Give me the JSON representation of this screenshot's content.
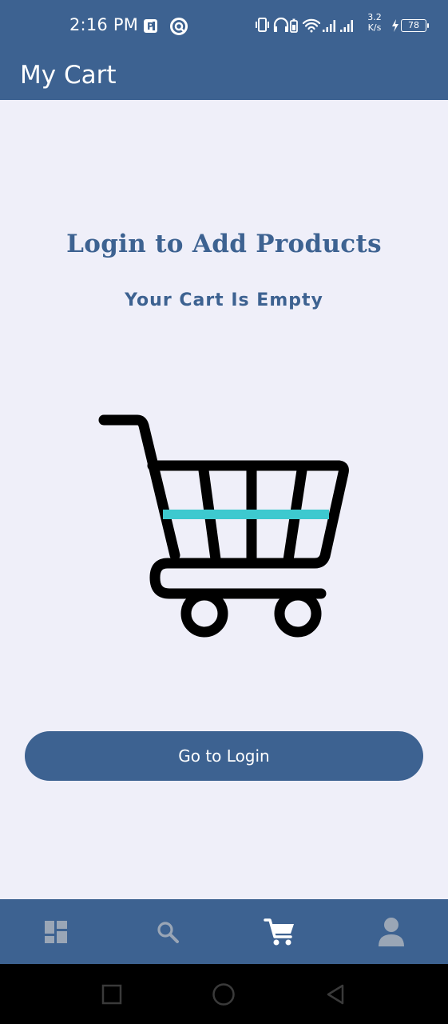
{
  "status_bar": {
    "time": "2:16 PM",
    "network_speed_value": "3.2",
    "network_speed_unit": "K/s",
    "battery_level": "78",
    "icons": [
      "parking-notification-icon",
      "app-notification-icon",
      "vibrate-icon",
      "headphones-icon",
      "battery-saver-icon",
      "wifi-icon",
      "signal-icon",
      "signal-icon",
      "charging-icon",
      "battery-icon"
    ]
  },
  "app_bar": {
    "title": "My Cart"
  },
  "empty_state": {
    "headline": "Login to Add Products",
    "subtitle": "Your Cart Is Empty",
    "illustration": "shopping-cart-illustration"
  },
  "login_button": {
    "label": "Go to Login"
  },
  "bottom_nav": {
    "items": [
      {
        "icon": "dashboard-icon",
        "active": false
      },
      {
        "icon": "search-icon",
        "active": false
      },
      {
        "icon": "cart-icon",
        "active": true
      },
      {
        "icon": "profile-icon",
        "active": false
      }
    ]
  },
  "system_nav": {
    "buttons": [
      "recents-button",
      "home-button",
      "back-button"
    ]
  },
  "colors": {
    "primary": "#3d6291",
    "background": "#efeff9",
    "accent_teal": "#3dc9cf",
    "nav_inactive": "#9aa6b6",
    "nav_active": "#ffffff"
  }
}
